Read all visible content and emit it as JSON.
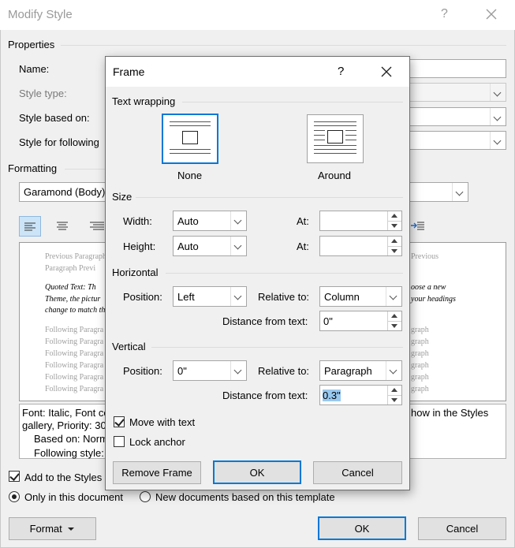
{
  "modify_style": {
    "title": "Modify Style",
    "help_label": "?",
    "properties_label": "Properties",
    "name_label": "Name:",
    "style_type_label": "Style type:",
    "style_based_on_label": "Style based on:",
    "style_following_label": "Style for following",
    "formatting_label": "Formatting",
    "font_value": "Garamond (Body)",
    "preview": {
      "prev_para_1": "Previous Paragraph",
      "prev_para_2": "Paragraph Previ",
      "prev_right": "Previous",
      "quoted_1": "Quoted Text: Th",
      "quoted_2": "Theme, the pictur",
      "quoted_3": "change to match th",
      "quoted_r1": "oose a new",
      "quoted_r2": "your headings",
      "following": [
        "Following Paragra",
        "Following Paragra",
        "Following Paragra",
        "Following Paragra",
        "Following Paragra",
        "Following Paragra"
      ],
      "following_right": [
        "graph",
        "graph",
        "graph",
        "graph",
        "graph",
        "graph"
      ]
    },
    "description": {
      "line1": "Font: Italic, Font co",
      "line1_right": "how in the Styles",
      "line2": "gallery, Priority: 30",
      "line3": "Based on: Norm",
      "line4": "Following style:"
    },
    "add_to_styles_label": "Add to the Styles",
    "only_this_doc_label": "Only in this document",
    "new_docs_label": "New documents based on this template",
    "format_button": "Format",
    "ok_button": "OK",
    "cancel_button": "Cancel"
  },
  "frame": {
    "title": "Frame",
    "help_label": "?",
    "text_wrapping_label": "Text wrapping",
    "wrap_none_label": "None",
    "wrap_around_label": "Around",
    "size_label": "Size",
    "width_label": "Width:",
    "width_value": "Auto",
    "height_label": "Height:",
    "height_value": "Auto",
    "at_label": "At:",
    "width_at_value": "",
    "height_at_value": "",
    "horizontal_label": "Horizontal",
    "h_position_label": "Position:",
    "h_position_value": "Left",
    "h_relative_label": "Relative to:",
    "h_relative_value": "Column",
    "h_distance_label": "Distance from text:",
    "h_distance_value": "0\"",
    "vertical_label": "Vertical",
    "v_position_label": "Position:",
    "v_position_value": "0\"",
    "v_relative_label": "Relative to:",
    "v_relative_value": "Paragraph",
    "v_distance_label": "Distance from text:",
    "v_distance_value": "0.3\"",
    "move_with_text_label": "Move with text",
    "lock_anchor_label": "Lock anchor",
    "remove_frame_button": "Remove Frame",
    "ok_button": "OK",
    "cancel_button": "Cancel"
  }
}
